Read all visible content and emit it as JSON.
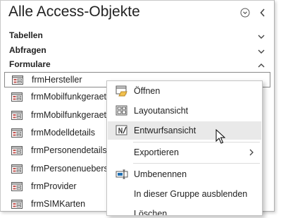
{
  "pane": {
    "title": "Alle Access-Objekte"
  },
  "groups": [
    {
      "label": "Tabellen",
      "state": "collapsed"
    },
    {
      "label": "Abfragen",
      "state": "collapsed"
    },
    {
      "label": "Formulare",
      "state": "expanded"
    }
  ],
  "forms": [
    {
      "label": "frmHersteller"
    },
    {
      "label": "frmMobilfunkgeraet"
    },
    {
      "label": "frmMobilfunkgeraet"
    },
    {
      "label": "frmModelldetails"
    },
    {
      "label": "frmPersonendetails"
    },
    {
      "label": "frmPersonenuebersi"
    },
    {
      "label": "frmProvider"
    },
    {
      "label": "frmSIMKarten"
    }
  ],
  "context_menu": {
    "items": [
      {
        "label": "Öffnen",
        "icon": "open-form-icon"
      },
      {
        "label": "Layoutansicht",
        "icon": "layout-view-icon"
      },
      {
        "label": "Entwurfsansicht",
        "icon": "design-view-icon"
      },
      {
        "label": "Exportieren",
        "icon": "",
        "submenu": true
      },
      {
        "label": "Umbenennen",
        "icon": "rename-icon"
      },
      {
        "label": "In dieser Gruppe ausblenden",
        "icon": ""
      },
      {
        "label": "Löschen",
        "icon": ""
      }
    ]
  },
  "colors": {
    "form_icon_accent": "#c0504d",
    "icon_gray": "#5a5a5a",
    "rename_blue": "#1f6fb2"
  }
}
